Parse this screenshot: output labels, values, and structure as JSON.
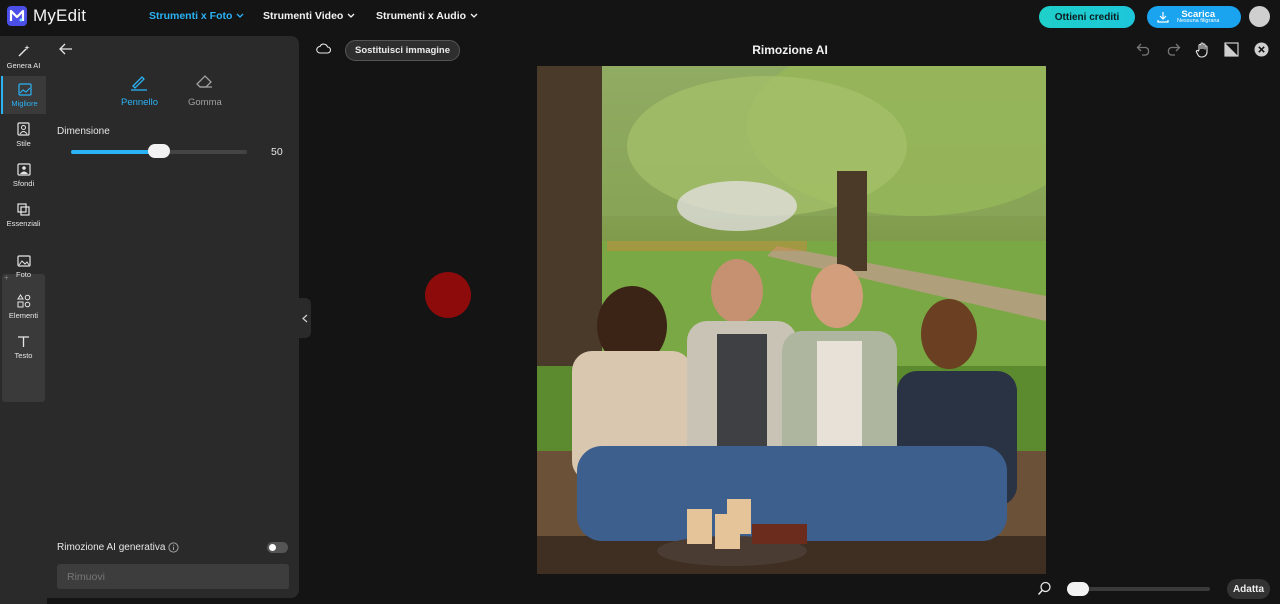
{
  "app": {
    "name": "MyEdit"
  },
  "topnav": [
    {
      "label": "Strumenti x Foto",
      "active": true
    },
    {
      "label": "Strumenti Video",
      "active": false
    },
    {
      "label": "Strumenti x Audio",
      "active": false
    }
  ],
  "header_actions": {
    "credits_label": "Ottieni crediti",
    "download_label": "Scarica",
    "download_sub": "Nessuna filigrana"
  },
  "rail": [
    {
      "label": "Genera AI",
      "icon": "magic-wand-icon"
    },
    {
      "label": "Migliore",
      "icon": "enhance-image-icon",
      "active": true
    },
    {
      "label": "Stile",
      "icon": "portrait-style-icon"
    },
    {
      "label": "Sfondi",
      "icon": "background-icon"
    },
    {
      "label": "Essenziali",
      "icon": "crop-essentials-icon"
    },
    {
      "label": "Foto",
      "icon": "photo-icon"
    },
    {
      "label": "Elementi",
      "icon": "elements-icon"
    },
    {
      "label": "Testo",
      "icon": "text-icon"
    }
  ],
  "panel": {
    "tools": [
      {
        "label": "Pennello",
        "icon": "brush-icon",
        "active": true
      },
      {
        "label": "Gomma",
        "icon": "eraser-icon",
        "active": false
      }
    ],
    "size_label": "Dimensione",
    "size_value": "50",
    "size_fraction": 0.5,
    "generative_label": "Rimozione AI generativa",
    "generative_on": false,
    "remove_label": "Rimuovi"
  },
  "canvas": {
    "replace_label": "Sostituisci immagine",
    "title": "Rimozione AI",
    "zoom_fraction": 0.0,
    "fit_label": "Adatta"
  },
  "colors": {
    "accent": "#2ab3f5",
    "credits": "#1fd0c9",
    "brush": "#8e0b0b"
  }
}
